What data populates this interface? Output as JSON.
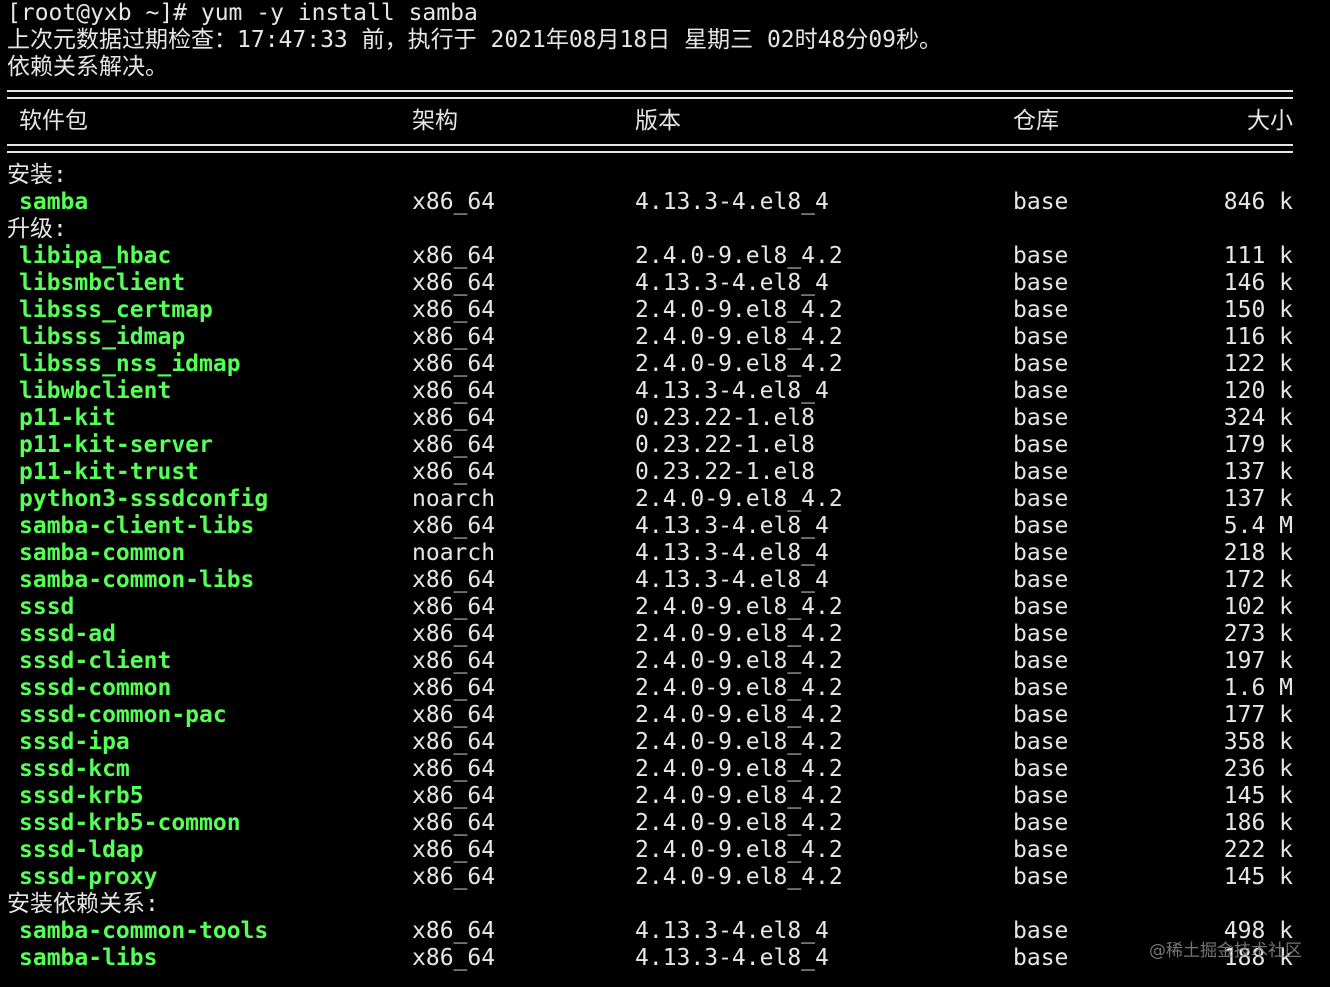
{
  "terminal": {
    "prompt_line": "[root@yxb ~]# yum -y install samba",
    "metadata_line": "上次元数据过期检查：17:47:33 前，执行于 2021年08月18日 星期三 02时48分09秒。",
    "deps_resolved": "依赖关系解决。"
  },
  "table": {
    "headers": {
      "name": "软件包",
      "arch": "架构",
      "version": "版本",
      "repo": "仓库",
      "size": "大小"
    },
    "sections": [
      {
        "title": "安装:",
        "rows": [
          {
            "name": "samba",
            "arch": "x86_64",
            "version": "4.13.3-4.el8_4",
            "repo": "base",
            "size": "846 k"
          }
        ]
      },
      {
        "title": "升级:",
        "rows": [
          {
            "name": "libipa_hbac",
            "arch": "x86_64",
            "version": "2.4.0-9.el8_4.2",
            "repo": "base",
            "size": "111 k"
          },
          {
            "name": "libsmbclient",
            "arch": "x86_64",
            "version": "4.13.3-4.el8_4",
            "repo": "base",
            "size": "146 k"
          },
          {
            "name": "libsss_certmap",
            "arch": "x86_64",
            "version": "2.4.0-9.el8_4.2",
            "repo": "base",
            "size": "150 k"
          },
          {
            "name": "libsss_idmap",
            "arch": "x86_64",
            "version": "2.4.0-9.el8_4.2",
            "repo": "base",
            "size": "116 k"
          },
          {
            "name": "libsss_nss_idmap",
            "arch": "x86_64",
            "version": "2.4.0-9.el8_4.2",
            "repo": "base",
            "size": "122 k"
          },
          {
            "name": "libwbclient",
            "arch": "x86_64",
            "version": "4.13.3-4.el8_4",
            "repo": "base",
            "size": "120 k"
          },
          {
            "name": "p11-kit",
            "arch": "x86_64",
            "version": "0.23.22-1.el8",
            "repo": "base",
            "size": "324 k"
          },
          {
            "name": "p11-kit-server",
            "arch": "x86_64",
            "version": "0.23.22-1.el8",
            "repo": "base",
            "size": "179 k"
          },
          {
            "name": "p11-kit-trust",
            "arch": "x86_64",
            "version": "0.23.22-1.el8",
            "repo": "base",
            "size": "137 k"
          },
          {
            "name": "python3-sssdconfig",
            "arch": "noarch",
            "version": "2.4.0-9.el8_4.2",
            "repo": "base",
            "size": "137 k"
          },
          {
            "name": "samba-client-libs",
            "arch": "x86_64",
            "version": "4.13.3-4.el8_4",
            "repo": "base",
            "size": "5.4 M"
          },
          {
            "name": "samba-common",
            "arch": "noarch",
            "version": "4.13.3-4.el8_4",
            "repo": "base",
            "size": "218 k"
          },
          {
            "name": "samba-common-libs",
            "arch": "x86_64",
            "version": "4.13.3-4.el8_4",
            "repo": "base",
            "size": "172 k"
          },
          {
            "name": "sssd",
            "arch": "x86_64",
            "version": "2.4.0-9.el8_4.2",
            "repo": "base",
            "size": "102 k"
          },
          {
            "name": "sssd-ad",
            "arch": "x86_64",
            "version": "2.4.0-9.el8_4.2",
            "repo": "base",
            "size": "273 k"
          },
          {
            "name": "sssd-client",
            "arch": "x86_64",
            "version": "2.4.0-9.el8_4.2",
            "repo": "base",
            "size": "197 k"
          },
          {
            "name": "sssd-common",
            "arch": "x86_64",
            "version": "2.4.0-9.el8_4.2",
            "repo": "base",
            "size": "1.6 M"
          },
          {
            "name": "sssd-common-pac",
            "arch": "x86_64",
            "version": "2.4.0-9.el8_4.2",
            "repo": "base",
            "size": "177 k"
          },
          {
            "name": "sssd-ipa",
            "arch": "x86_64",
            "version": "2.4.0-9.el8_4.2",
            "repo": "base",
            "size": "358 k"
          },
          {
            "name": "sssd-kcm",
            "arch": "x86_64",
            "version": "2.4.0-9.el8_4.2",
            "repo": "base",
            "size": "236 k"
          },
          {
            "name": "sssd-krb5",
            "arch": "x86_64",
            "version": "2.4.0-9.el8_4.2",
            "repo": "base",
            "size": "145 k"
          },
          {
            "name": "sssd-krb5-common",
            "arch": "x86_64",
            "version": "2.4.0-9.el8_4.2",
            "repo": "base",
            "size": "186 k"
          },
          {
            "name": "sssd-ldap",
            "arch": "x86_64",
            "version": "2.4.0-9.el8_4.2",
            "repo": "base",
            "size": "222 k"
          },
          {
            "name": "sssd-proxy",
            "arch": "x86_64",
            "version": "2.4.0-9.el8_4.2",
            "repo": "base",
            "size": "145 k"
          }
        ]
      },
      {
        "title": "安装依赖关系:",
        "rows": [
          {
            "name": "samba-common-tools",
            "arch": "x86_64",
            "version": "4.13.3-4.el8_4",
            "repo": "base",
            "size": "498 k"
          },
          {
            "name": "samba-libs",
            "arch": "x86_64",
            "version": "4.13.3-4.el8_4",
            "repo": "base",
            "size": "188 k"
          }
        ]
      }
    ]
  },
  "watermark": "@稀土掘金技术社区",
  "colors": {
    "background": "#000000",
    "text": "#e6e6e6",
    "package_name": "#55ff55"
  }
}
